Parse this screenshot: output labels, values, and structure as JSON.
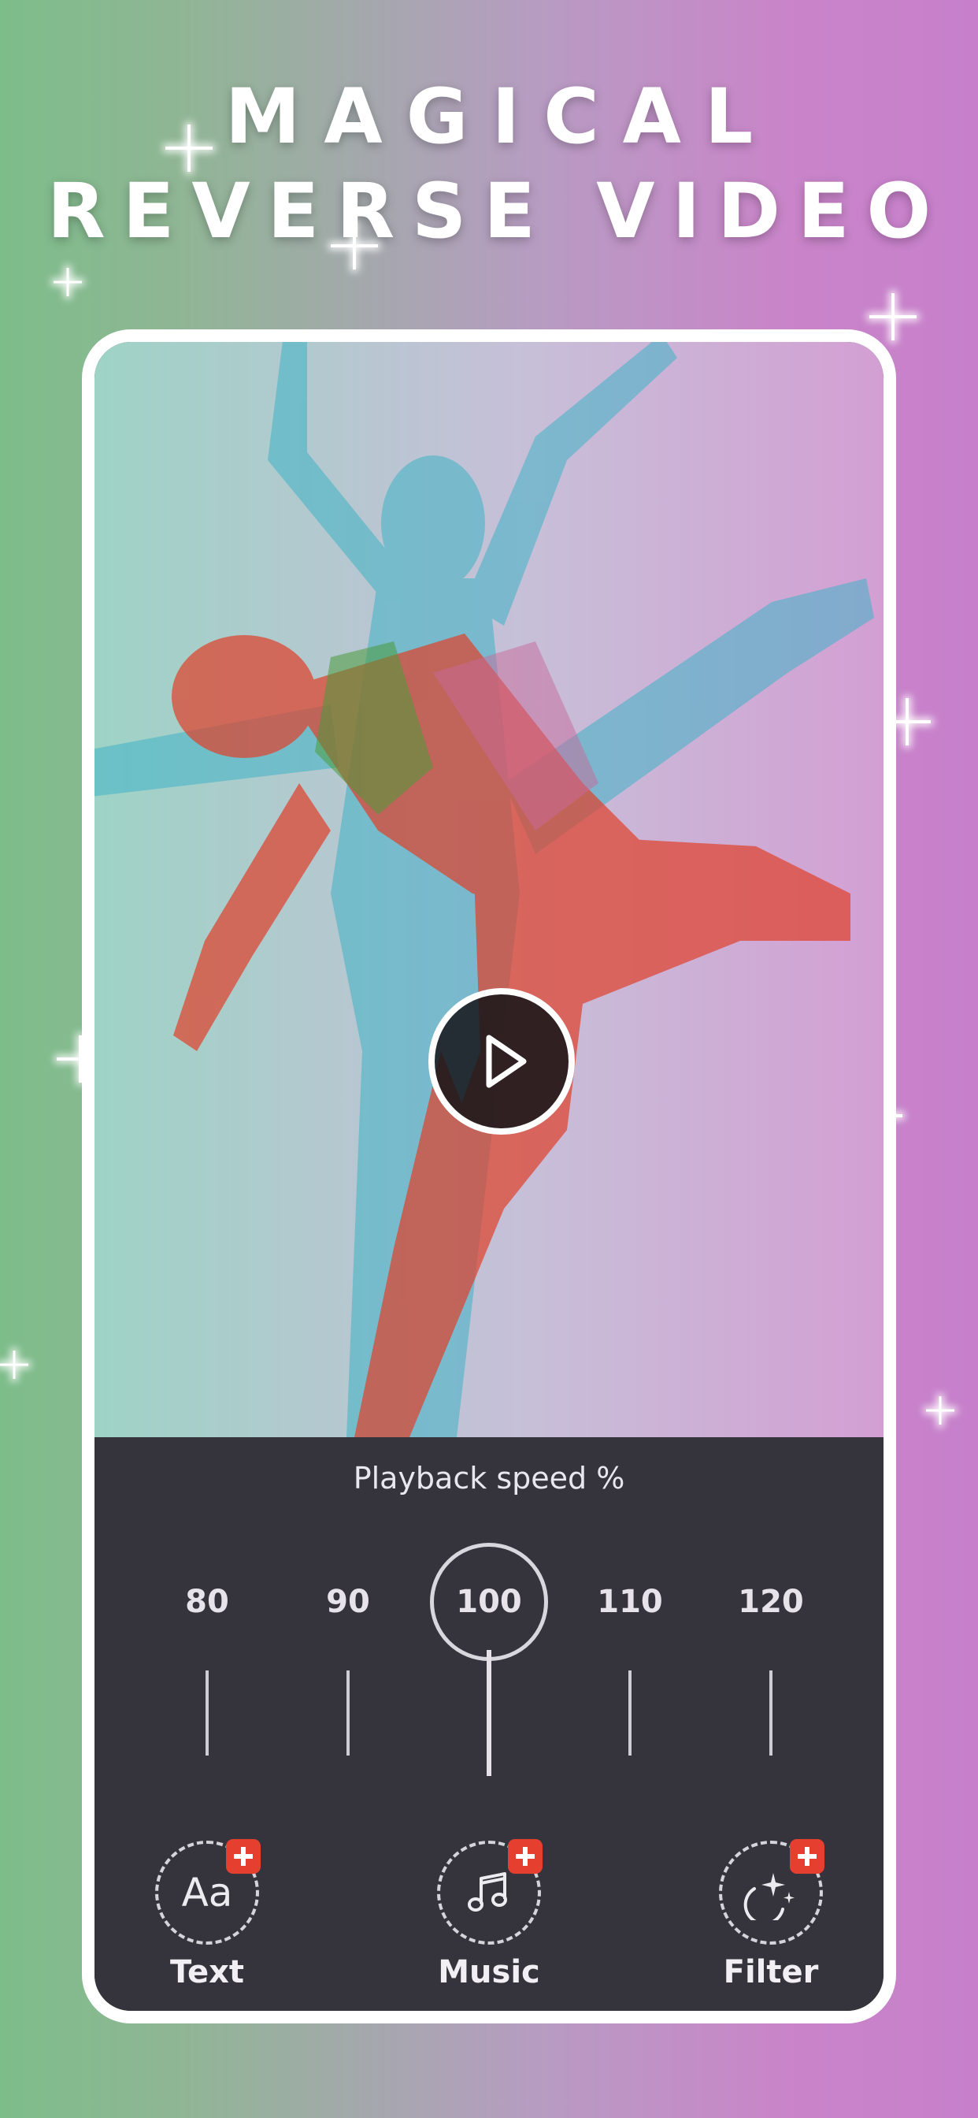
{
  "headline": {
    "line1": "MAGICAL",
    "line2": "REVERSE VIDEO"
  },
  "video": {
    "play_icon": "play-icon",
    "state": "paused"
  },
  "speed": {
    "title": "Playback speed %",
    "options": [
      "80",
      "90",
      "100",
      "110",
      "120"
    ],
    "selected": "100"
  },
  "tools": [
    {
      "label": "Text",
      "glyph": "Aa",
      "icon": "text-icon"
    },
    {
      "label": "Music",
      "icon": "music-note-icon"
    },
    {
      "label": "Filter",
      "icon": "sparkle-moon-icon"
    }
  ],
  "colors": {
    "background_left": "#7dbd8a",
    "background_right": "#c77fcb",
    "panel": "#35333b",
    "badge": "#e5402f",
    "frame": "#ffffff"
  }
}
